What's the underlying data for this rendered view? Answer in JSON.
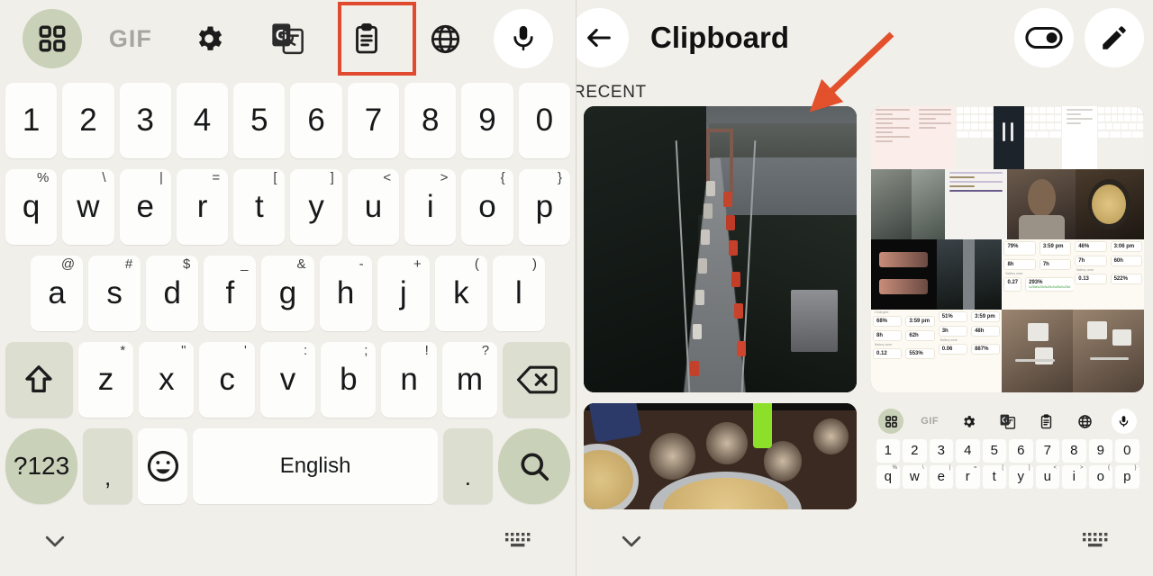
{
  "left_panel": {
    "toolbar": {
      "items": [
        {
          "name": "grid-icon",
          "label": "",
          "style": "sage"
        },
        {
          "name": "gif-icon",
          "label": "GIF",
          "style": "text"
        },
        {
          "name": "settings-gear-icon",
          "label": "",
          "style": "plain"
        },
        {
          "name": "translate-icon",
          "label": "",
          "style": "plain"
        },
        {
          "name": "clipboard-icon",
          "label": "",
          "style": "plain"
        },
        {
          "name": "globe-icon",
          "label": "",
          "style": "plain"
        },
        {
          "name": "microphone-icon",
          "label": "",
          "style": "white"
        }
      ],
      "highlight_color": "#e04a2f",
      "highlighted_item": "clipboard-icon"
    },
    "keyboard": {
      "number_row": [
        "1",
        "2",
        "3",
        "4",
        "5",
        "6",
        "7",
        "8",
        "9",
        "0"
      ],
      "row1": [
        {
          "key": "q",
          "sup": "%"
        },
        {
          "key": "w",
          "sup": "\\"
        },
        {
          "key": "e",
          "sup": "|"
        },
        {
          "key": "r",
          "sup": "="
        },
        {
          "key": "t",
          "sup": "["
        },
        {
          "key": "y",
          "sup": "]"
        },
        {
          "key": "u",
          "sup": "<"
        },
        {
          "key": "i",
          "sup": ">"
        },
        {
          "key": "o",
          "sup": "{"
        },
        {
          "key": "p",
          "sup": "}"
        }
      ],
      "row2": [
        {
          "key": "a",
          "sup": "@"
        },
        {
          "key": "s",
          "sup": "#"
        },
        {
          "key": "d",
          "sup": "$"
        },
        {
          "key": "f",
          "sup": "_"
        },
        {
          "key": "g",
          "sup": "&"
        },
        {
          "key": "h",
          "sup": "-"
        },
        {
          "key": "j",
          "sup": "+"
        },
        {
          "key": "k",
          "sup": "("
        },
        {
          "key": "l",
          "sup": ")"
        }
      ],
      "row3": [
        {
          "key": "z",
          "sup": "*"
        },
        {
          "key": "x",
          "sup": "\""
        },
        {
          "key": "c",
          "sup": "'"
        },
        {
          "key": "v",
          "sup": ":"
        },
        {
          "key": "b",
          "sup": ";"
        },
        {
          "key": "n",
          "sup": "!"
        },
        {
          "key": "m",
          "sup": "?"
        }
      ],
      "shift_key": "shift-key",
      "backspace_key": "backspace-key",
      "bottom_row": {
        "symbols_label": "?123",
        "comma_label": ",",
        "emoji_label": "☺",
        "space_label": "English",
        "period_label": ".",
        "search_label": "search-icon"
      }
    },
    "navbar": {
      "hide_keyboard": "chevron-down-icon",
      "keyboard_switch": "keyboard-icon"
    }
  },
  "right_panel": {
    "header": {
      "back_label": "back-arrow-icon",
      "title": "Clipboard",
      "toggle_label": "toggle-switch-icon",
      "toggle_state": "on",
      "edit_label": "pencil-edit-icon"
    },
    "section_label": "RECENT",
    "clips": [
      {
        "name": "clip-bridge-photo",
        "kind": "image",
        "description": "Suspension bridge with traffic"
      },
      {
        "name": "clip-screenshot-collage",
        "kind": "image",
        "description": "Grid collage of phone screenshots"
      },
      {
        "name": "clip-food-photo",
        "kind": "image",
        "description": "Biryani plates on floral cloth"
      }
    ],
    "mini_keyboard": {
      "toolbar": [
        "grid-icon",
        "GIF",
        "settings-gear-icon",
        "translate-icon",
        "clipboard-icon",
        "globe-icon",
        "microphone-icon"
      ],
      "number_row": [
        "1",
        "2",
        "3",
        "4",
        "5",
        "6",
        "7",
        "8",
        "9",
        "0"
      ],
      "letter_row": [
        {
          "key": "q",
          "sup": "%"
        },
        {
          "key": "w",
          "sup": "\\"
        },
        {
          "key": "e",
          "sup": "|"
        },
        {
          "key": "r",
          "sup": "="
        },
        {
          "key": "t",
          "sup": "["
        },
        {
          "key": "y",
          "sup": "]"
        },
        {
          "key": "u",
          "sup": "<"
        },
        {
          "key": "i",
          "sup": ">"
        },
        {
          "key": "o",
          "sup": "{"
        },
        {
          "key": "p",
          "sup": "}"
        }
      ]
    },
    "navbar": {
      "hide_keyboard": "chevron-down-icon",
      "keyboard_switch": "keyboard-icon"
    },
    "annotation": {
      "type": "arrow",
      "color": "#e2512c",
      "points_to": "clip-bridge-photo"
    }
  },
  "collage_stats": {
    "cards": [
      {
        "value": "79%",
        "time": "3:59 pm",
        "screen_on": "8h",
        "screen_off": "7h",
        "wear": "0.27",
        "eff": "293%"
      },
      {
        "value": "46%",
        "time": "3:06 pm",
        "screen_on": "7h",
        "screen_off": "60h",
        "wear": "0.13",
        "eff": "522%"
      },
      {
        "value": "68%",
        "time": "3:59 pm",
        "screen_on": "8h",
        "screen_off": "62h",
        "wear": "0.12",
        "eff": "553%"
      },
      {
        "value": "51%",
        "time": "3:59 pm",
        "screen_on": "3h",
        "screen_off": "48h",
        "wear": "0.06",
        "eff": "887%"
      }
    ],
    "labels": {
      "charged": "Charged",
      "battery_wear": "Battery wear",
      "charge_speed": "Charge speed"
    }
  }
}
